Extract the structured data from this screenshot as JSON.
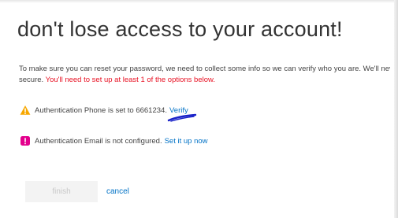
{
  "title": "don't lose access to your account!",
  "description": {
    "line1": "To make sure you can reset your password, we need to collect some info so we can verify who you are. We'll never use this to spam you - just to keep your account more secure.",
    "line2_prefix": "secure.",
    "line2_warning": "You'll need to set up at least 1 of the options below."
  },
  "phone": {
    "icon": "warning-triangle-icon",
    "icon_color": "#f7a700",
    "text": "Authentication Phone is set to 6661234.",
    "action": "Verify"
  },
  "email": {
    "icon": "error-exclamation-icon",
    "icon_color": "#e3008c",
    "text": "Authentication Email is not configured.",
    "action": "Set it up now"
  },
  "actions": {
    "finish_label": "finish",
    "cancel_label": "cancel"
  },
  "colors": {
    "link": "#0072c6",
    "warning_text": "#e81123",
    "annotation_scribble": "#1a23c9"
  }
}
